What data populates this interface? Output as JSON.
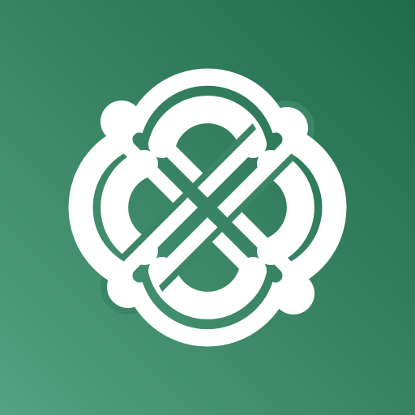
{
  "app_icon": {
    "icon": "celtic-knot-logo-icon",
    "colors": {
      "background_light": "#54a283",
      "background_mid": "#3a8666",
      "background_dark": "#1f6b4c",
      "knot": "#ffffff"
    }
  }
}
